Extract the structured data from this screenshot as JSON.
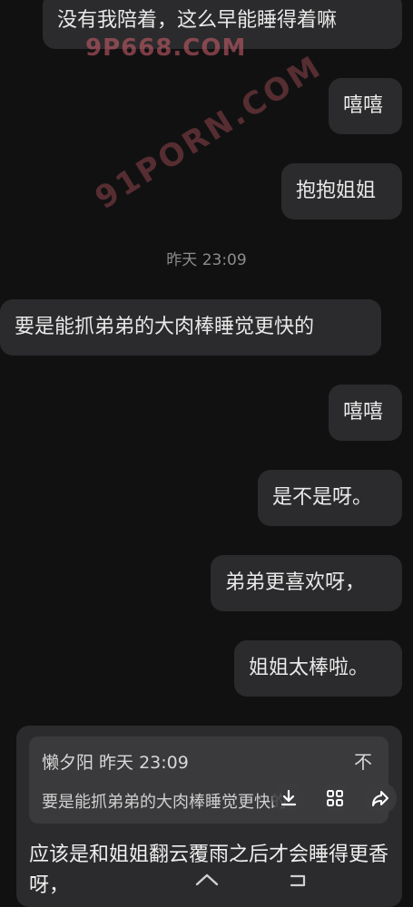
{
  "messages": [
    {
      "text": "没有我陪着，这么早能睡得着嘛"
    },
    {
      "text": "嘻嘻"
    },
    {
      "text": "抱抱姐姐"
    },
    {
      "text": "要是能抓弟弟的大肉棒睡觉更快的"
    },
    {
      "text": "嘻嘻"
    },
    {
      "text": "是不是呀。"
    },
    {
      "text": "弟弟更喜欢呀，"
    },
    {
      "text": "姐姐太棒啦。"
    }
  ],
  "timestamp": "昨天 23:09",
  "watermarks": [
    "9P668.COM",
    "91PORN.COM"
  ],
  "quote": {
    "header": "懒夕阳  昨天 23:09",
    "body": "要是能抓弟弟的大肉棒睡觉更快的",
    "close_glyph": "不"
  },
  "reply_text": "应该是和姐姐翻云覆雨之后才会睡得更香呀，",
  "icons": [
    "download-icon",
    "grid-icon",
    "share-icon",
    "home-icon",
    "back-icon"
  ],
  "colors": {
    "background": "#111112",
    "bubble": "#2b2b2d",
    "watermark": "#d6606e"
  }
}
